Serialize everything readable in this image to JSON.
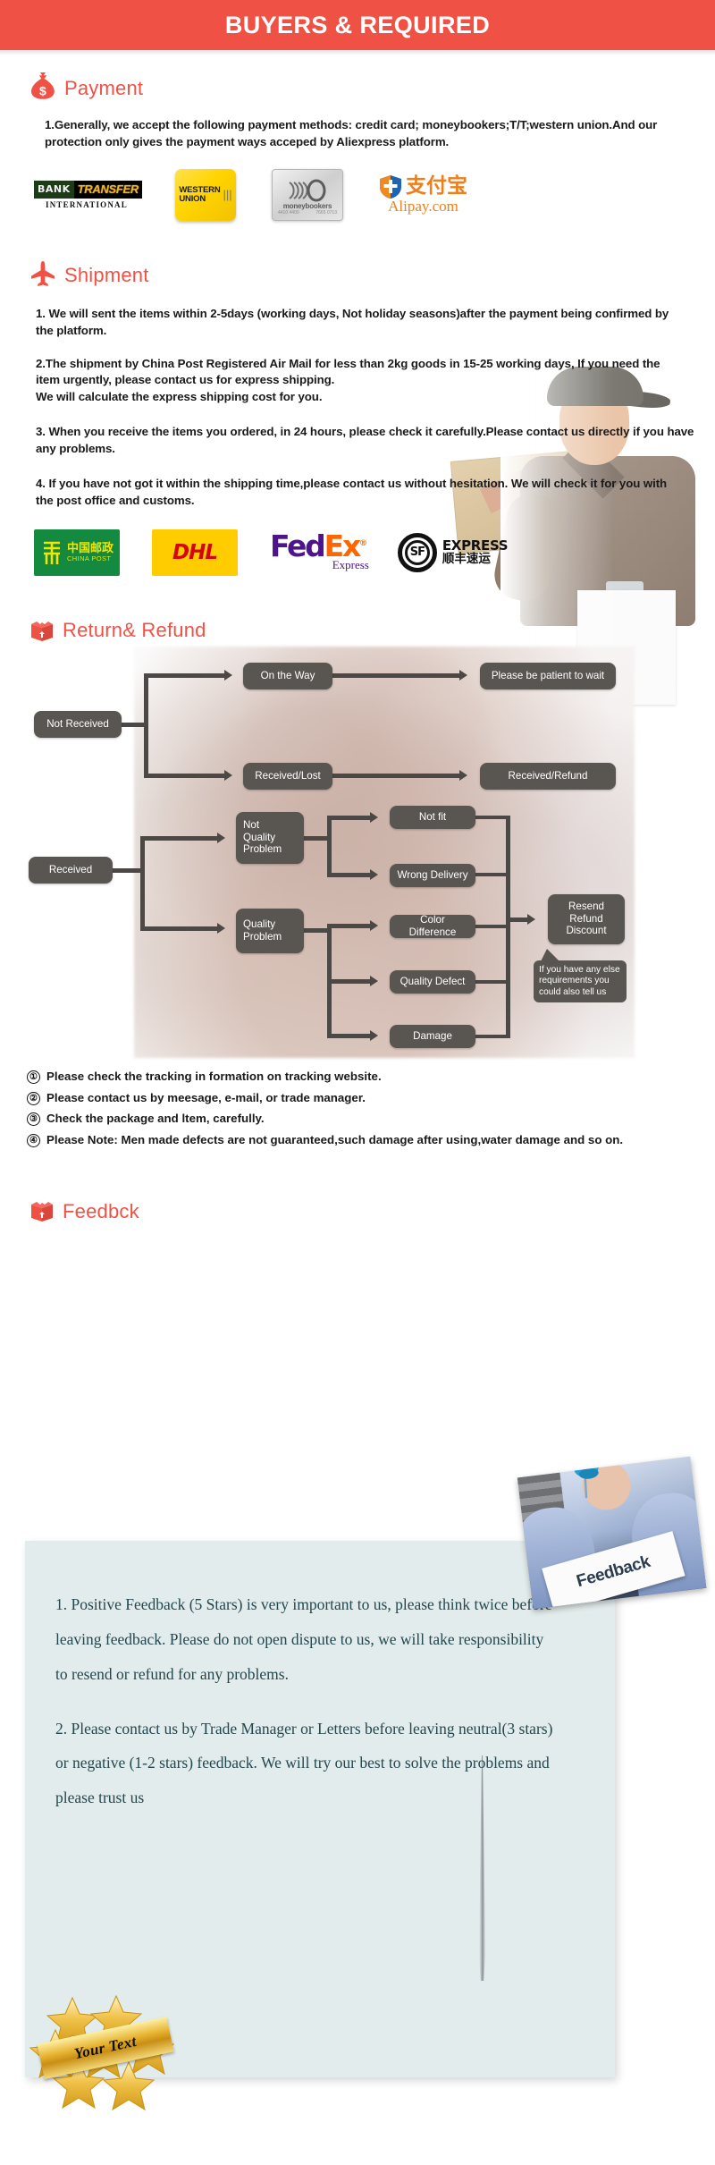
{
  "banner": {
    "title": "BUYERS & REQUIRED",
    "color": "#ef5244"
  },
  "sections": {
    "payment": {
      "heading": "Payment",
      "icon": "money-bag-icon",
      "paragraph": "1.Generally, we accept the following payment methods: credit card; moneybookers;T/T;western union.And our protection only gives the payment ways acceped by Aliexpress platform.",
      "logos": [
        {
          "name": "bank-transfer-logo",
          "line1": "BANK",
          "line2": "TRANSFER",
          "line3": "INTERNATIONAL"
        },
        {
          "name": "western-union-logo",
          "line1": "WESTERN",
          "line2": "UNION"
        },
        {
          "name": "moneybookers-logo",
          "line1": "moneybookers",
          "num_left": "4410 4400",
          "num_right": "7665 0713"
        },
        {
          "name": "alipay-logo",
          "line1": "支付宝",
          "line2": "Alipay.com"
        }
      ]
    },
    "shipment": {
      "heading": "Shipment",
      "icon": "airplane-icon",
      "paragraphs": [
        "1. We will sent the items within 2-5days (working days, Not holiday seasons)after the payment being confirmed by the platform.",
        "2.The shipment by China Post Registered Air Mail for less than  2kg goods in 15-25 working days, If  you need the item urgently, please contact us for express shipping.\nWe will calculate the express shipping cost for you.",
        "3. When you receive the items you ordered, in 24 hours, please check  it carefully.Please contact us directly if you have any problems.",
        "4. If you have not got it within the shipping time,please contact us without hesitation. We will check it for you with the post office and customs."
      ],
      "carriers": [
        {
          "name": "china-post-logo",
          "cn": "中国邮政",
          "en": "CHINA POST"
        },
        {
          "name": "dhl-logo",
          "text": "DHL"
        },
        {
          "name": "fedex-logo",
          "part1": "Fed",
          "part2": "Ex",
          "reg": "®",
          "sub": "Express"
        },
        {
          "name": "sf-express-logo",
          "mark": "SF",
          "en": "EXPRESS",
          "cn": "顺丰速运"
        }
      ]
    },
    "return_refund": {
      "heading": "Return& Refund",
      "icon": "open-box-icon",
      "flowchart": {
        "nodes": [
          {
            "id": "not-received",
            "label": "Not Received"
          },
          {
            "id": "on-the-way",
            "label": "On the Way"
          },
          {
            "id": "please-be-patient",
            "label": "Please be patient to wait"
          },
          {
            "id": "received-lost",
            "label": "Received/Lost"
          },
          {
            "id": "received-refund",
            "label": "Received/Refund"
          },
          {
            "id": "received",
            "label": "Received"
          },
          {
            "id": "not-quality-problem",
            "label": "Not\nQuality\nProblem"
          },
          {
            "id": "quality-problem",
            "label": "Quality\nProblem"
          },
          {
            "id": "not-fit",
            "label": "Not fit"
          },
          {
            "id": "wrong-delivery",
            "label": "Wrong Delivery"
          },
          {
            "id": "color-difference",
            "label": "Color Difference"
          },
          {
            "id": "quality-defect",
            "label": "Quality Defect"
          },
          {
            "id": "damage",
            "label": "Damage"
          },
          {
            "id": "resend-refund-discount",
            "label": "Resend\nRefund\nDiscount"
          }
        ],
        "callout": "If you have any else\nrequirements you\ncould also tell us"
      },
      "notes": [
        {
          "num": "①",
          "text": "Please check the tracking in formation on tracking website."
        },
        {
          "num": "②",
          "text": "Please contact us by meesage, e-mail, or trade manager."
        },
        {
          "num": "③",
          "text": "Check the package and ltem, carefully."
        },
        {
          "num": "④",
          "text": "Please Note: Men made defects  are not guaranteed,such damage after using,water damage and so on."
        }
      ]
    },
    "feedback": {
      "heading": "Feedbck",
      "icon": "open-box-icon",
      "photo_card_text": "Feedback",
      "paragraphs": [
        "1. Positive Feedback (5 Stars) is very important to us, please think twice before leaving feedback. Please do not open dispute to us,   we will take responsibility to resend or refund for any problems.",
        "2. Please contact us by Trade Manager or Letters before leaving neutral(3 stars) or negative (1-2 stars) feedback. We will try our best to solve the problems and please trust us"
      ],
      "badge_text": "Your Text"
    }
  }
}
